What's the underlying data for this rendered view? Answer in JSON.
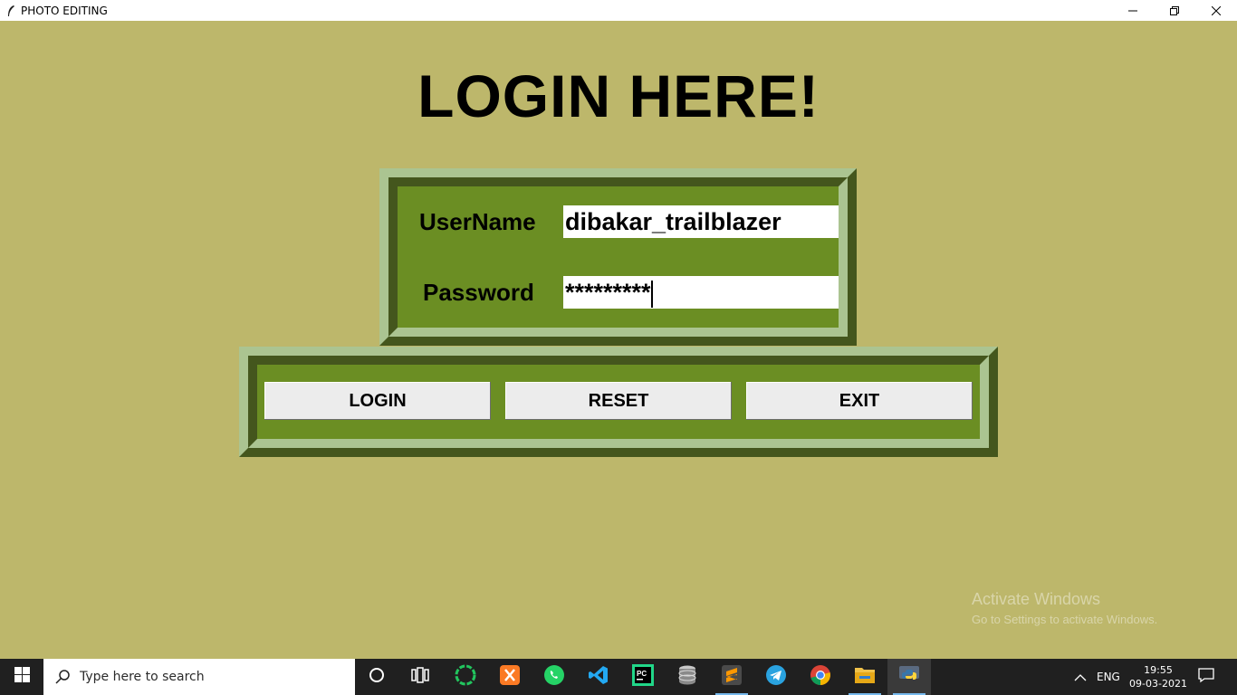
{
  "window": {
    "title": "PHOTO EDITING",
    "controls": {
      "minimize": "—",
      "restore": "❐",
      "close": "✕"
    }
  },
  "page": {
    "heading": "LOGIN HERE!"
  },
  "form": {
    "username_label": "UserName",
    "username_value": "dibakar_trailblazer",
    "password_label": "Password",
    "password_value": "*********"
  },
  "actions": {
    "login": "LOGIN",
    "reset": "RESET",
    "exit": "EXIT"
  },
  "watermark": {
    "title": "Activate Windows",
    "subtitle": "Go to Settings to activate Windows."
  },
  "taskbar": {
    "search_placeholder": "Type here to search",
    "pinned": [
      "cortana-icon",
      "task-view-icon",
      "circular-app-icon",
      "xampp-icon",
      "whatsapp-icon",
      "vscode-icon",
      "pycharm-icon",
      "database-icon",
      "sublime-icon",
      "telegram-icon",
      "chrome-icon",
      "file-explorer-icon",
      "python-icon"
    ],
    "tray": {
      "language": "ENG",
      "time": "19:55",
      "date": "09-03-2021"
    }
  },
  "colors": {
    "background": "#bdb76b",
    "panel": "#6b8e23",
    "ridge_light": "#abc491",
    "ridge_dark": "#44561d",
    "button": "#ececec",
    "taskbar": "#202020"
  }
}
